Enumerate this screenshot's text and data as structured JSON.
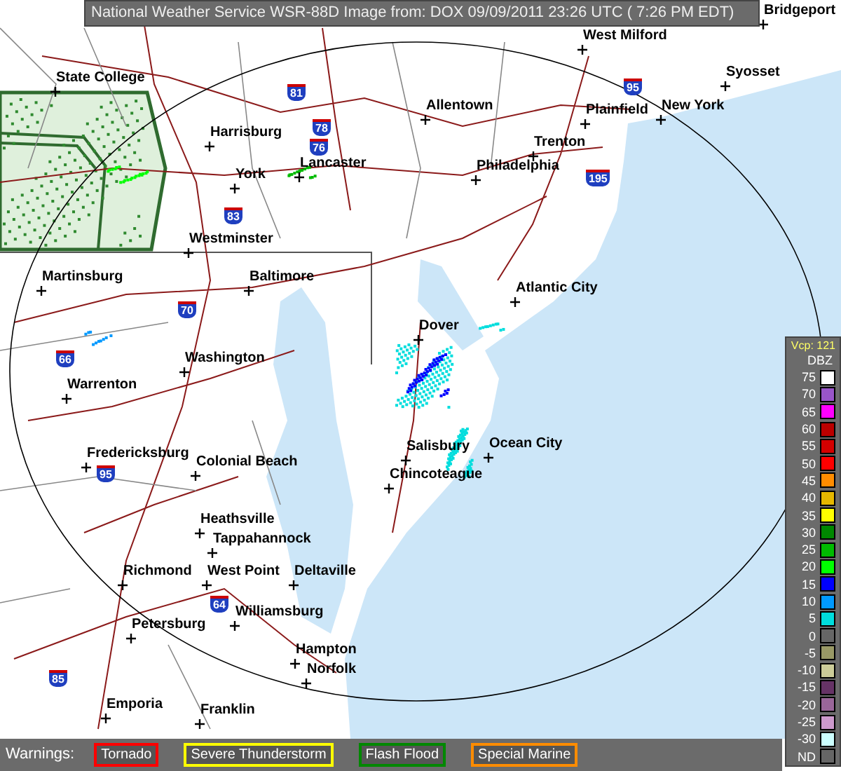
{
  "header": {
    "title": "National Weather Service WSR-88D Image from: DOX 09/09/2011 23:26 UTC ( 7:26 PM EDT)"
  },
  "cities": [
    "West Milford",
    "Bridgeport",
    "State College",
    "Allentown",
    "Plainfield",
    "New York",
    "Syosset",
    "Harrisburg",
    "Lancaster",
    "York",
    "Trenton",
    "Philadelphia",
    "Westminster",
    "Martinsburg",
    "Baltimore",
    "Atlantic City",
    "Dover",
    "Washington",
    "Warrenton",
    "Salisbury",
    "Ocean City",
    "Fredericksburg",
    "Colonial Beach",
    "Chincoteague",
    "Heathsville",
    "Tappahannock",
    "Richmond",
    "West Point",
    "Deltaville",
    "Williamsburg",
    "Petersburg",
    "Hampton",
    "Norfolk",
    "Emporia",
    "Franklin"
  ],
  "highway_shields": [
    "81",
    "78",
    "76",
    "195",
    "83",
    "70",
    "95",
    "66",
    "95",
    "64",
    "85"
  ],
  "legend": {
    "vcp": "Vcp: 121",
    "unit": "DBZ",
    "levels": [
      {
        "label": "75",
        "color": "#ffffff"
      },
      {
        "label": "70",
        "color": "#9955c9"
      },
      {
        "label": "65",
        "color": "#ff00ff"
      },
      {
        "label": "60",
        "color": "#bb0000"
      },
      {
        "label": "55",
        "color": "#d40000"
      },
      {
        "label": "50",
        "color": "#ff0000"
      },
      {
        "label": "45",
        "color": "#ff8c00"
      },
      {
        "label": "40",
        "color": "#e6b800"
      },
      {
        "label": "35",
        "color": "#ffff00"
      },
      {
        "label": "30",
        "color": "#008800"
      },
      {
        "label": "25",
        "color": "#00bb00"
      },
      {
        "label": "20",
        "color": "#00ff00"
      },
      {
        "label": "15",
        "color": "#0000ff"
      },
      {
        "label": "10",
        "color": "#0099ff"
      },
      {
        "label": "5",
        "color": "#00dddd"
      },
      {
        "label": "0",
        "color": "#666666"
      },
      {
        "label": "-5",
        "color": "#999966"
      },
      {
        "label": "-10",
        "color": "#cccc99"
      },
      {
        "label": "-15",
        "color": "#663366"
      },
      {
        "label": "-20",
        "color": "#996699"
      },
      {
        "label": "-25",
        "color": "#cc99cc"
      },
      {
        "label": "-30",
        "color": "#ccffff"
      },
      {
        "label": "ND",
        "color": "#666666"
      }
    ]
  },
  "warnings": {
    "label": "Warnings:",
    "items": [
      {
        "label": "Tornado",
        "color": "#ff0000"
      },
      {
        "label": "Severe Thunderstorm",
        "color": "#ffff00"
      },
      {
        "label": "Flash Flood",
        "color": "#008800"
      },
      {
        "label": "Special Marine",
        "color": "#ff8c00"
      }
    ]
  }
}
